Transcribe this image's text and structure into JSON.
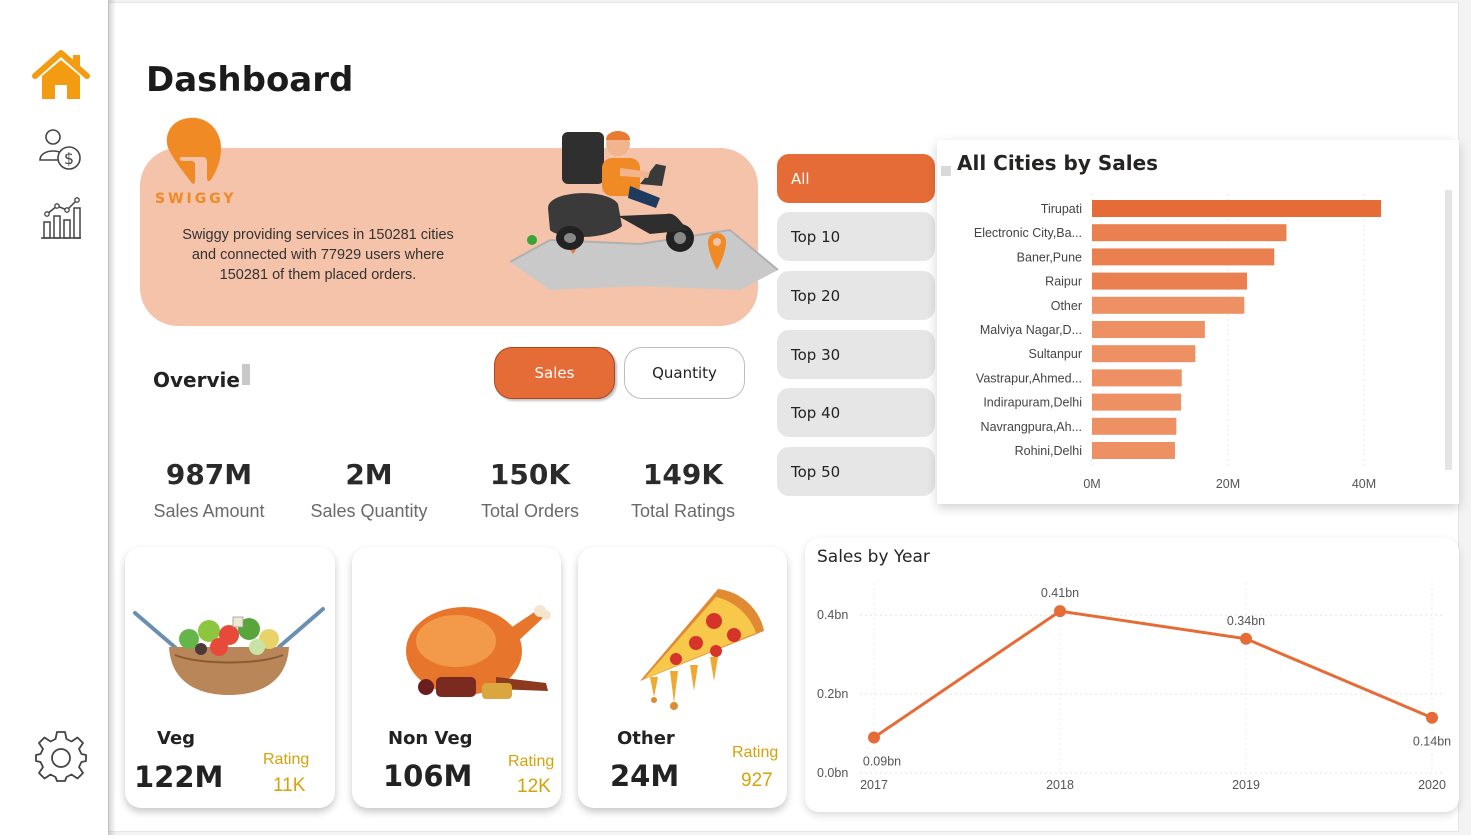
{
  "colors": {
    "accent": "#e66c37",
    "bar": "#e87a4a",
    "rating": "#d4a20a",
    "hero_bg": "#f5c2aa",
    "brand": "#f08a24"
  },
  "nav": {
    "items": [
      {
        "name": "home-icon",
        "active": true
      },
      {
        "name": "users-money-icon"
      },
      {
        "name": "bar-chart-icon"
      }
    ],
    "settings": "gear-icon"
  },
  "page": {
    "title": "Dashboard"
  },
  "hero": {
    "brand": "SWIGGY",
    "line1": "Swiggy providing services in 150281 cities",
    "line2": "and connected with 77929 users where",
    "line3": "150281 of them placed orders."
  },
  "overview": {
    "title": "Overvie",
    "toggle_sales": "Sales",
    "toggle_quantity": "Quantity"
  },
  "kpis": [
    {
      "value": "987M",
      "label": "Sales Amount"
    },
    {
      "value": "2M",
      "label": "Sales Quantity"
    },
    {
      "value": "150K",
      "label": "Total Orders"
    },
    {
      "value": "149K",
      "label": "Total Ratings"
    }
  ],
  "filters": [
    "All",
    "Top 10",
    "Top 20",
    "Top 30",
    "Top 40",
    "Top 50"
  ],
  "active_filter": "All",
  "food": [
    {
      "name": "Veg",
      "value": "122M",
      "rating_label": "Rating",
      "rating": "11K",
      "icon": "salad-icon"
    },
    {
      "name": "Non Veg",
      "value": "106M",
      "rating_label": "Rating",
      "rating": "12K",
      "icon": "roast-chicken-icon"
    },
    {
      "name": "Other",
      "value": "24M",
      "rating_label": "Rating",
      "rating": "927",
      "icon": "pizza-icon"
    }
  ],
  "chart_data": [
    {
      "type": "bar",
      "orientation": "horizontal",
      "title": "All Cities by Sales",
      "categories": [
        "Tirupati",
        "Electronic City,Ba...",
        "Baner,Pune",
        "Raipur",
        "Other",
        "Malviya Nagar,D...",
        "Sultanpur",
        "Vastrapur,Ahmed...",
        "Indirapuram,Delhi",
        "Navrangpura,Ah...",
        "Rohini,Delhi"
      ],
      "values": [
        42.5,
        28.6,
        26.8,
        22.8,
        22.4,
        16.6,
        15.2,
        13.2,
        13.1,
        12.4,
        12.2
      ],
      "unit": "M",
      "xlim": [
        0,
        50
      ],
      "ticks": [
        "0M",
        "20M",
        "40M"
      ],
      "grid": true
    },
    {
      "type": "line",
      "title": "Sales by Year",
      "x": [
        "2017",
        "2018",
        "2019",
        "2020"
      ],
      "values": [
        0.09,
        0.41,
        0.34,
        0.14
      ],
      "data_labels": [
        "0.09bn",
        "0.41bn",
        "0.34bn",
        "0.14bn"
      ],
      "ylim": [
        0,
        0.45
      ],
      "yticks": [
        "0.0bn",
        "0.2bn",
        "0.4bn"
      ],
      "grid": true
    }
  ]
}
